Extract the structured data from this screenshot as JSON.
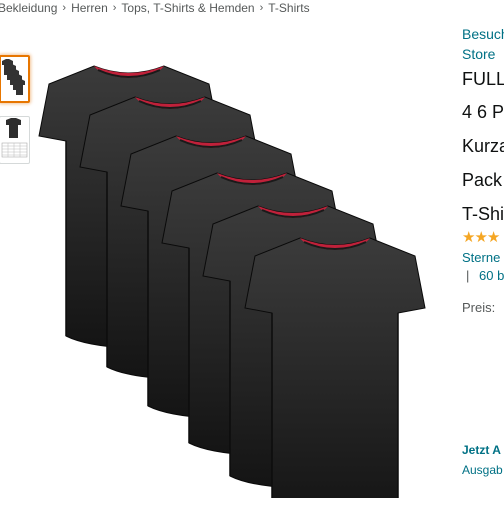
{
  "breadcrumb": {
    "items": [
      "Bekleidung",
      "Herren",
      "Tops, T-Shirts & Hemden",
      "T-Shirts"
    ],
    "separator": "›"
  },
  "gallery": {
    "thumbnails": [
      {
        "name": "six-pack-black-tshirts",
        "selected": true
      },
      {
        "name": "size-chart-tshirt",
        "selected": false
      }
    ],
    "main_image": "six black t-shirts stacked diagonally"
  },
  "product": {
    "store_link_line1": "Besuch",
    "store_link_line2": "Store",
    "title_lines": [
      "FULL",
      "4 6 P",
      "Kurza",
      "Pack",
      "T-Shi"
    ],
    "stars_partial": "★★★",
    "rating_label": "Sterne",
    "rating_separator": "|",
    "rating_count": "60 b",
    "price_label": "Preis:",
    "delivery_link": "Jetzt A",
    "size_guide_link": "Ausgab"
  },
  "colors": {
    "link": "#007185",
    "star": "#f5a623",
    "thumb_selected_border": "#e77600",
    "shirt_body": "#2a2a2a",
    "shirt_collar": "#c0213a"
  }
}
